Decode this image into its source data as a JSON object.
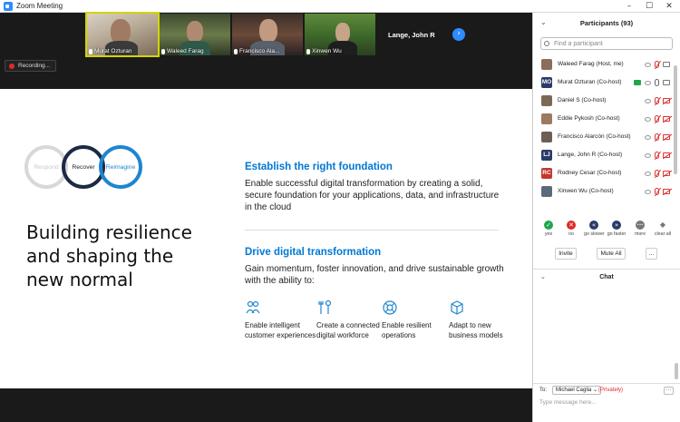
{
  "window": {
    "title": "Zoom Meeting",
    "controls": {
      "minimize": "–",
      "maximize": "☐",
      "close": "✕"
    }
  },
  "video_strip": {
    "tiles": [
      {
        "name": "Murat Ozturan"
      },
      {
        "name": "Waleed Farag"
      },
      {
        "name": "Francisco Ala..."
      },
      {
        "name": "Xinwen Wu"
      }
    ],
    "name_only_tile": "Lange, John R",
    "next_arrow": "›"
  },
  "recording": {
    "label": "Recording..."
  },
  "slide": {
    "rings": [
      "Respond",
      "Recover",
      "Reimagine"
    ],
    "headline": "Building resilience and shaping the new normal",
    "section1": {
      "title": "Establish the right foundation",
      "text": "Enable successful digital transformation by creating a solid, secure foundation for your applications, data, and infrastructure in the cloud"
    },
    "section2": {
      "title": "Drive digital transformation",
      "text": "Gain momentum, foster innovation, and drive sustainable growth with the ability to:"
    },
    "features": [
      {
        "icon": "people-icon",
        "text": "Enable intelligent customer experiences"
      },
      {
        "icon": "tools-icon",
        "text": "Create a connected digital workforce"
      },
      {
        "icon": "lifebuoy-icon",
        "text": "Enable resilient operations"
      },
      {
        "icon": "box-icon",
        "text": "Adapt to new business models"
      }
    ]
  },
  "participants": {
    "title": "Participants (93)",
    "search_placeholder": "Find a participant",
    "list": [
      {
        "name": "Waleed Farag (Host, me)",
        "avatar": "photo",
        "color": "#8a6d5a",
        "initials": ""
      },
      {
        "name": "Murat Ozturan (Co-host)",
        "avatar": "initials",
        "color": "#2b3a67",
        "initials": "MO"
      },
      {
        "name": "Daniel S (Co-host)",
        "avatar": "photo",
        "color": "#7a6a55",
        "initials": ""
      },
      {
        "name": "Eddie Pykosh (Co-host)",
        "avatar": "photo",
        "color": "#9a7a60",
        "initials": ""
      },
      {
        "name": "Francisco Alarcón (Co-host)",
        "avatar": "photo",
        "color": "#6d5f56",
        "initials": ""
      },
      {
        "name": "Lange, John R (Co-host)",
        "avatar": "initials",
        "color": "#2b3a67",
        "initials": "LJ"
      },
      {
        "name": "Rodney Cesar (Co-host)",
        "avatar": "initials",
        "color": "#c0392b",
        "initials": "RC"
      },
      {
        "name": "Xinwen Wu (Co-host)",
        "avatar": "photo",
        "color": "#5b6a7a",
        "initials": ""
      }
    ],
    "reactions": [
      {
        "label": "yes",
        "glyph": "✓",
        "color": "#1fa64a"
      },
      {
        "label": "no",
        "glyph": "✕",
        "color": "#e02828"
      },
      {
        "label": "go slower",
        "glyph": "«",
        "color": "#2b3a67"
      },
      {
        "label": "go faster",
        "glyph": "»",
        "color": "#2b3a67"
      },
      {
        "label": "more",
        "glyph": "•••",
        "color": "#777777"
      },
      {
        "label": "clear all",
        "glyph": "◆",
        "color": "#777777"
      }
    ],
    "buttons": {
      "invite": "Invite",
      "mute_all": "Mute All",
      "more": "..."
    }
  },
  "chat": {
    "title": "Chat",
    "to_label": "To:",
    "recipient": "Michael Caglia ⌄",
    "privacy": "(Privately)",
    "more": "···",
    "input_placeholder": "Type message here..."
  },
  "colors": {
    "accent": "#2D8CFF",
    "slide_blue": "#0078d4",
    "danger": "#e02828",
    "success": "#1fa64a"
  }
}
